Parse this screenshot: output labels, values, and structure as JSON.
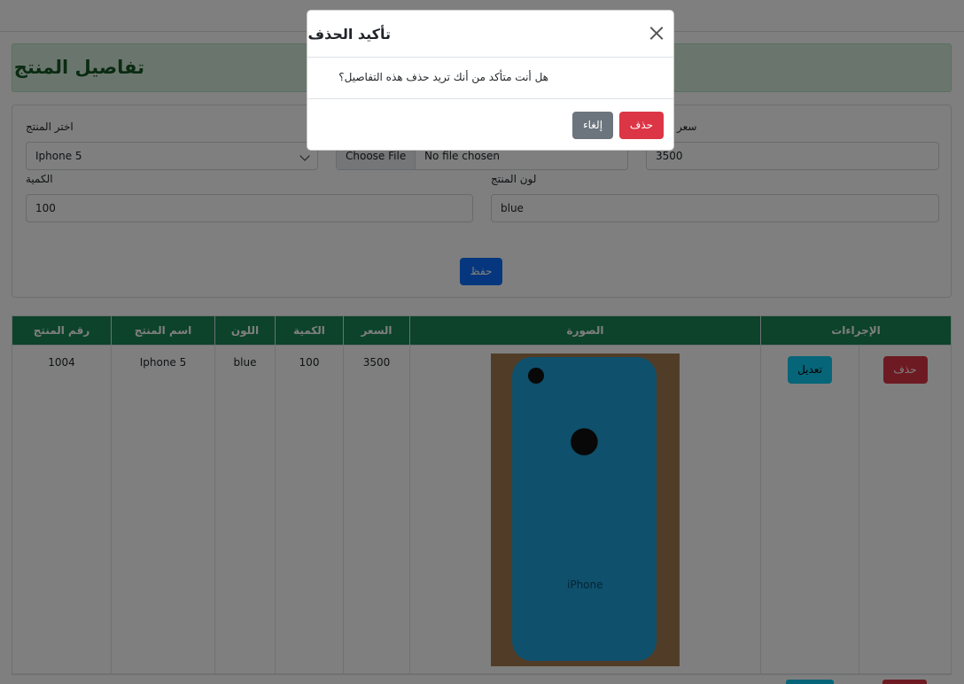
{
  "page": {
    "title": "تفاصيل المنتج"
  },
  "form": {
    "product_label": "اختر المنتج",
    "product_value": "Iphone 5",
    "file_button": "Choose File",
    "file_text": "No file chosen",
    "price_label": "سعر",
    "price_value": "3500",
    "quantity_label": "الكمية",
    "quantity_value": "100",
    "color_label": "لون المنتج",
    "color_value": "blue",
    "save_label": "حفظ"
  },
  "table": {
    "headers": [
      "الإجراءات",
      "الصورة",
      "السعر",
      "الكمية",
      "اللون",
      "اسم المنتج",
      "رقم المنتج"
    ],
    "rows": [
      {
        "id": "1004",
        "name": "Iphone 5",
        "color": "blue",
        "quantity": "100",
        "price": "3500",
        "image_caption": "iPhone",
        "edit_label": "تعديل",
        "delete_label": "حذف"
      }
    ]
  },
  "modal": {
    "title": "تأكيد الحذف",
    "body": "هل أنت متأكد من أنك تريد حذف هذه التفاصيل؟",
    "delete_label": "حذف",
    "cancel_label": "إلغاء"
  }
}
